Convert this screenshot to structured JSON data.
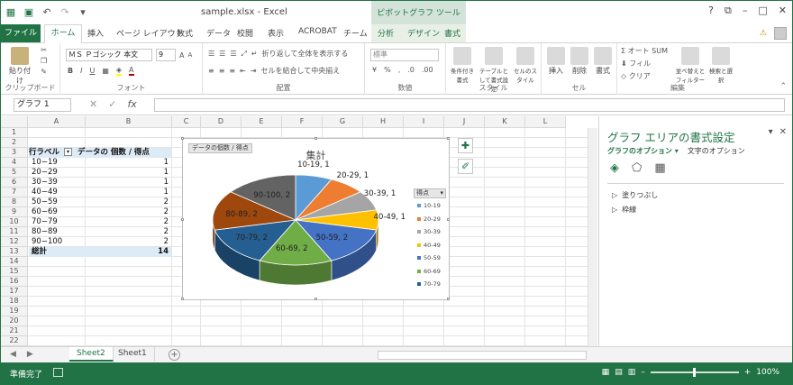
{
  "title_bar": {
    "doc_title": "sample.xlsx - Excel",
    "pivot_tools": "ピボットグラフ ツール",
    "controls": [
      "?",
      "⧉",
      "–",
      "□",
      "✕"
    ]
  },
  "tabs": {
    "file": "ファイル",
    "home": "ホーム",
    "items": [
      "挿入",
      "ページ レイアウト",
      "数式",
      "データ",
      "校閲",
      "表示",
      "ACROBAT",
      "チーム",
      "分析",
      "デザイン",
      "書式"
    ]
  },
  "ribbon": {
    "clipboard": {
      "paste": "貼り付け",
      "label": "クリップボード"
    },
    "font": {
      "name": "ＭＳ Ｐゴシック 本文",
      "size": "9",
      "label": "フォント",
      "bold": "B",
      "italic": "I",
      "underline": "U",
      "grow": "A",
      "shrink": "A"
    },
    "alignment": {
      "wrap": "折り返して全体を表示する",
      "merge": "セルを結合して中央揃え",
      "label": "配置"
    },
    "number": {
      "format": "標準",
      "percent": "%",
      "comma": ",",
      "label": "数値"
    },
    "styles": {
      "conditional": "条件付き書式",
      "table": "テーブルとして書式設定",
      "cell": "セルのスタイル",
      "label": "スタイル"
    },
    "cells": {
      "insert": "挿入",
      "delete": "削除",
      "format": "書式",
      "label": "セル"
    },
    "editing": {
      "autosum": "オート SUM",
      "fill": "フィル",
      "clear": "クリア",
      "sort": "並べ替えとフィルター",
      "find": "検索と選択",
      "label": "編集"
    }
  },
  "formula_bar": {
    "name_box": "グラフ 1",
    "fx": "fx"
  },
  "columns": [
    "A",
    "B",
    "C",
    "D",
    "E",
    "F",
    "G",
    "H",
    "I",
    "J",
    "K",
    "L"
  ],
  "rows": [
    "1",
    "2",
    "3",
    "4",
    "5",
    "6",
    "7",
    "8",
    "9",
    "10",
    "11",
    "12",
    "13",
    "14",
    "15",
    "16",
    "17",
    "18",
    "19",
    "20",
    "21",
    "22"
  ],
  "pivot": {
    "header_label": "行ラベル",
    "header_value": "データの 個数 / 得点",
    "rows": [
      {
        "label": "10−19",
        "value": "1"
      },
      {
        "label": "20−29",
        "value": "1"
      },
      {
        "label": "30−39",
        "value": "1"
      },
      {
        "label": "40−49",
        "value": "1"
      },
      {
        "label": "50−59",
        "value": "2"
      },
      {
        "label": "60−69",
        "value": "2"
      },
      {
        "label": "70−79",
        "value": "2"
      },
      {
        "label": "80−89",
        "value": "2"
      },
      {
        "label": "90−100",
        "value": "2"
      }
    ],
    "total_label": "総計",
    "total_value": "14"
  },
  "chart_data": {
    "type": "pie",
    "title": "集計",
    "field_chip": "データの個数 / 得点",
    "legend_field": "得点",
    "categories": [
      "10-19",
      "20-29",
      "30-39",
      "40-49",
      "50-59",
      "60-69",
      "70-79",
      "80-89",
      "90-100"
    ],
    "values": [
      1,
      1,
      1,
      1,
      2,
      2,
      2,
      2,
      2
    ],
    "data_labels": [
      "10-19, 1",
      "20-29, 1",
      "30-39, 1",
      "40-49, 1",
      "50-59, 2",
      "60-69, 2",
      "70-79, 2",
      "80-89, 2",
      "90-100, 2"
    ],
    "legend_visible": [
      "10-19",
      "20-29",
      "30-39",
      "40-49",
      "50-59",
      "60-69",
      "70-79"
    ],
    "colors": [
      "#5b9bd5",
      "#ed7d31",
      "#a5a5a5",
      "#ffc000",
      "#4472c4",
      "#70ad47",
      "#255e91",
      "#9e480e",
      "#636363"
    ],
    "legend_placement": "right"
  },
  "format_pane": {
    "title": "グラフ エリアの書式設定",
    "tab_options": "グラフのオプション",
    "tab_text": "文字のオプション",
    "items": [
      "塗りつぶし",
      "枠線"
    ]
  },
  "sheet_tabs": [
    "Sheet2",
    "Sheet1"
  ],
  "status": {
    "ready": "準備完了",
    "zoom": "100%"
  }
}
